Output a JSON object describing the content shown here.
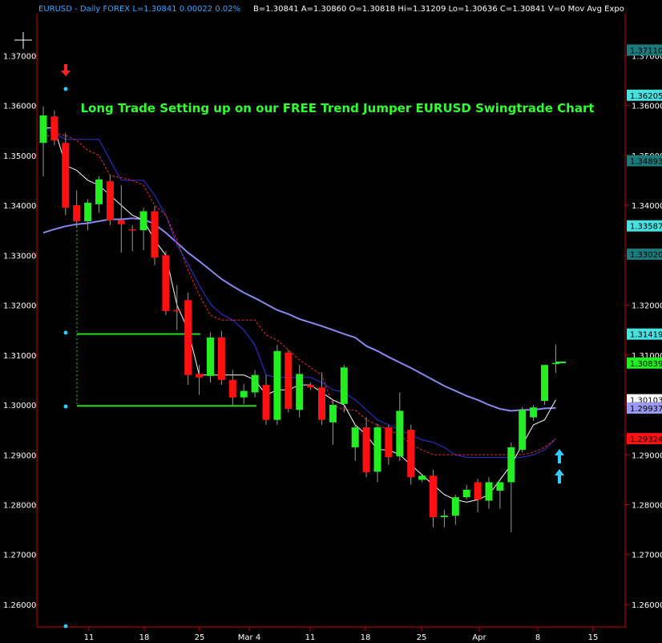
{
  "header": {
    "symbol_info": "EURUSD - Daily  FOREX  L=1.30841  0.00022   0.02%",
    "quote_info": "B=1.30841  A=1.30860  O=1.30818  Hi=1.31209  Lo=1.30636  C=1.30841  V=0  Mov Avg Expo"
  },
  "chart_data": {
    "type": "candlestick",
    "title": "Long Trade Setting up on our FREE Trend Jumper EURUSD Swingtrade Chart",
    "ylim": [
      1.2555,
      1.3784
    ],
    "y_ticks": [
      "1.37000",
      "1.36000",
      "1.35000",
      "1.34000",
      "1.33000",
      "1.32000",
      "1.31000",
      "1.30000",
      "1.29000",
      "1.28000",
      "1.27000",
      "1.26000"
    ],
    "x_ticks": [
      "11",
      "18",
      "25",
      "Mar 4",
      "11",
      "18",
      "25",
      "Apr",
      "8",
      "15"
    ],
    "price_labels": [
      {
        "text": "1.37110",
        "value": 1.3711,
        "bg": "#1e7a7a",
        "fg": "#000000"
      },
      {
        "text": "1.36205",
        "value": 1.36205,
        "bg": "#4ae0e0",
        "fg": "#000000"
      },
      {
        "text": "1.34893",
        "value": 1.34893,
        "bg": "#1e7a7a",
        "fg": "#000000"
      },
      {
        "text": "1.33587",
        "value": 1.33587,
        "bg": "#4ae0e0",
        "fg": "#000000"
      },
      {
        "text": "1.33020",
        "value": 1.3302,
        "bg": "#1e7a7a",
        "fg": "#000000"
      },
      {
        "text": "1.31419",
        "value": 1.31419,
        "bg": "#4ae0e0",
        "fg": "#000000"
      },
      {
        "text": "1.30839",
        "value": 1.30839,
        "bg": "#22ee22",
        "fg": "#000000"
      },
      {
        "text": "1.30103",
        "value": 1.30103,
        "bg": "#ffffff",
        "fg": "#000000"
      },
      {
        "text": "1.29937",
        "value": 1.29937,
        "bg": "#9a9af0",
        "fg": "#000000"
      },
      {
        "text": "1.29324",
        "value": 1.29324,
        "bg": "#ff1111",
        "fg": "#000000"
      }
    ],
    "candles": [
      {
        "o": 1.3525,
        "h": 1.3598,
        "l": 1.3458,
        "c": 1.358
      },
      {
        "o": 1.3578,
        "h": 1.359,
        "l": 1.352,
        "c": 1.353
      },
      {
        "o": 1.3525,
        "h": 1.3545,
        "l": 1.338,
        "c": 1.3395
      },
      {
        "o": 1.34,
        "h": 1.343,
        "l": 1.3355,
        "c": 1.3368
      },
      {
        "o": 1.3368,
        "h": 1.3412,
        "l": 1.335,
        "c": 1.3405
      },
      {
        "o": 1.3402,
        "h": 1.3458,
        "l": 1.3385,
        "c": 1.3452
      },
      {
        "o": 1.3448,
        "h": 1.346,
        "l": 1.336,
        "c": 1.337
      },
      {
        "o": 1.337,
        "h": 1.344,
        "l": 1.3305,
        "c": 1.3362
      },
      {
        "o": 1.3352,
        "h": 1.336,
        "l": 1.3308,
        "c": 1.335
      },
      {
        "o": 1.335,
        "h": 1.3395,
        "l": 1.331,
        "c": 1.3388
      },
      {
        "o": 1.3388,
        "h": 1.3398,
        "l": 1.328,
        "c": 1.3295
      },
      {
        "o": 1.33,
        "h": 1.3308,
        "l": 1.318,
        "c": 1.3188
      },
      {
        "o": 1.319,
        "h": 1.324,
        "l": 1.315,
        "c": 1.3188
      },
      {
        "o": 1.321,
        "h": 1.3225,
        "l": 1.304,
        "c": 1.306
      },
      {
        "o": 1.3062,
        "h": 1.308,
        "l": 1.302,
        "c": 1.3055
      },
      {
        "o": 1.3058,
        "h": 1.3145,
        "l": 1.3045,
        "c": 1.3135
      },
      {
        "o": 1.3135,
        "h": 1.3148,
        "l": 1.304,
        "c": 1.305
      },
      {
        "o": 1.305,
        "h": 1.307,
        "l": 1.3,
        "c": 1.3015
      },
      {
        "o": 1.3015,
        "h": 1.3042,
        "l": 1.3002,
        "c": 1.3028
      },
      {
        "o": 1.3025,
        "h": 1.307,
        "l": 1.3015,
        "c": 1.306
      },
      {
        "o": 1.304,
        "h": 1.306,
        "l": 1.296,
        "c": 1.297
      },
      {
        "o": 1.297,
        "h": 1.312,
        "l": 1.296,
        "c": 1.3108
      },
      {
        "o": 1.3105,
        "h": 1.311,
        "l": 1.2985,
        "c": 1.2992
      },
      {
        "o": 1.299,
        "h": 1.308,
        "l": 1.2975,
        "c": 1.3062
      },
      {
        "o": 1.304,
        "h": 1.3045,
        "l": 1.303,
        "c": 1.3035
      },
      {
        "o": 1.3035,
        "h": 1.3065,
        "l": 1.296,
        "c": 1.297
      },
      {
        "o": 1.2965,
        "h": 1.301,
        "l": 1.292,
        "c": 1.3
      },
      {
        "o": 1.3002,
        "h": 1.308,
        "l": 1.2985,
        "c": 1.3075
      },
      {
        "o": 1.2915,
        "h": 1.296,
        "l": 1.2888,
        "c": 1.2955
      },
      {
        "o": 1.2955,
        "h": 1.2975,
        "l": 1.2855,
        "c": 1.2865
      },
      {
        "o": 1.2866,
        "h": 1.2962,
        "l": 1.2845,
        "c": 1.2955
      },
      {
        "o": 1.2955,
        "h": 1.296,
        "l": 1.288,
        "c": 1.2895
      },
      {
        "o": 1.2897,
        "h": 1.3025,
        "l": 1.2888,
        "c": 1.2988
      },
      {
        "o": 1.295,
        "h": 1.296,
        "l": 1.284,
        "c": 1.2855
      },
      {
        "o": 1.285,
        "h": 1.286,
        "l": 1.2845,
        "c": 1.2858
      },
      {
        "o": 1.2858,
        "h": 1.287,
        "l": 1.2755,
        "c": 1.2775
      },
      {
        "o": 1.2775,
        "h": 1.279,
        "l": 1.2755,
        "c": 1.2778
      },
      {
        "o": 1.2778,
        "h": 1.282,
        "l": 1.276,
        "c": 1.2815
      },
      {
        "o": 1.2815,
        "h": 1.284,
        "l": 1.281,
        "c": 1.283
      },
      {
        "o": 1.2845,
        "h": 1.2852,
        "l": 1.2785,
        "c": 1.281
      },
      {
        "o": 1.2808,
        "h": 1.2855,
        "l": 1.2792,
        "c": 1.2845
      },
      {
        "o": 1.2828,
        "h": 1.2845,
        "l": 1.2792,
        "c": 1.2845
      },
      {
        "o": 1.2845,
        "h": 1.2925,
        "l": 1.2745,
        "c": 1.2915
      },
      {
        "o": 1.291,
        "h": 1.2995,
        "l": 1.2905,
        "c": 1.299
      },
      {
        "o": 1.2975,
        "h": 1.3,
        "l": 1.2968,
        "c": 1.2995
      },
      {
        "o": 1.3008,
        "h": 1.308,
        "l": 1.3,
        "c": 1.308
      },
      {
        "o": 1.3082,
        "h": 1.3121,
        "l": 1.3064,
        "c": 1.3084
      }
    ],
    "series": [
      {
        "color": "#8888ee",
        "values": [
          1.3345,
          1.3352,
          1.3358,
          1.3362,
          1.3364,
          1.3368,
          1.3372,
          1.3372,
          1.3374,
          1.3372,
          1.3362,
          1.3345,
          1.3325,
          1.3305,
          1.3288,
          1.327,
          1.3252,
          1.3238,
          1.3225,
          1.3214,
          1.3202,
          1.319,
          1.3182,
          1.3172,
          1.3165,
          1.3158,
          1.315,
          1.3142,
          1.3135,
          1.3118,
          1.3108,
          1.3096,
          1.3085,
          1.3074,
          1.3062,
          1.305,
          1.3038,
          1.3028,
          1.3018,
          1.301,
          1.3,
          1.2992,
          1.2988,
          1.299,
          1.299,
          1.2993,
          1.2994
        ]
      },
      {
        "color": "#3333dd",
        "values": [
          1.3558,
          1.3545,
          1.3532,
          1.3532,
          1.3532,
          1.3532,
          1.349,
          1.345,
          1.345,
          1.345,
          1.342,
          1.338,
          1.332,
          1.3282,
          1.324,
          1.3202,
          1.3182,
          1.317,
          1.315,
          1.312,
          1.306,
          1.3055,
          1.3055,
          1.3055,
          1.3055,
          1.3045,
          1.303,
          1.3025,
          1.301,
          1.299,
          1.297,
          1.296,
          1.295,
          1.294,
          1.293,
          1.2925,
          1.2915,
          1.29,
          1.2895,
          1.2895,
          1.2895,
          1.2895,
          1.2895,
          1.2895,
          1.29,
          1.291,
          1.2932
        ]
      },
      {
        "color": "#dd3333",
        "dash": "3,2",
        "values": [
          1.3535,
          1.3545,
          1.354,
          1.353,
          1.351,
          1.35,
          1.346,
          1.3455,
          1.345,
          1.344,
          1.34,
          1.338,
          1.333,
          1.327,
          1.322,
          1.318,
          1.317,
          1.317,
          1.317,
          1.317,
          1.314,
          1.313,
          1.311,
          1.309,
          1.3075,
          1.306,
          1.3,
          1.299,
          1.299,
          1.297,
          1.296,
          1.295,
          1.294,
          1.292,
          1.291,
          1.29,
          1.29,
          1.29,
          1.29,
          1.29,
          1.29,
          1.29,
          1.29,
          1.29,
          1.2905,
          1.2915,
          1.2932
        ]
      },
      {
        "color": "#ffffff",
        "values": [
          1.3555,
          1.3555,
          1.348,
          1.347,
          1.345,
          1.344,
          1.342,
          1.34,
          1.338,
          1.337,
          1.333,
          1.33,
          1.32,
          1.315,
          1.306,
          1.306,
          1.306,
          1.306,
          1.306,
          1.305,
          1.302,
          1.303,
          1.303,
          1.304,
          1.304,
          1.3025,
          1.301,
          1.3,
          1.296,
          1.294,
          1.291,
          1.291,
          1.29,
          1.288,
          1.286,
          1.284,
          1.282,
          1.281,
          1.2805,
          1.281,
          1.282,
          1.285,
          1.288,
          1.292,
          1.296,
          1.297,
          1.301
        ]
      }
    ],
    "trade_levels": [
      {
        "value": 1.31419,
        "color": "#22dd22"
      },
      {
        "value": 1.2998,
        "color": "#22dd22"
      }
    ]
  }
}
